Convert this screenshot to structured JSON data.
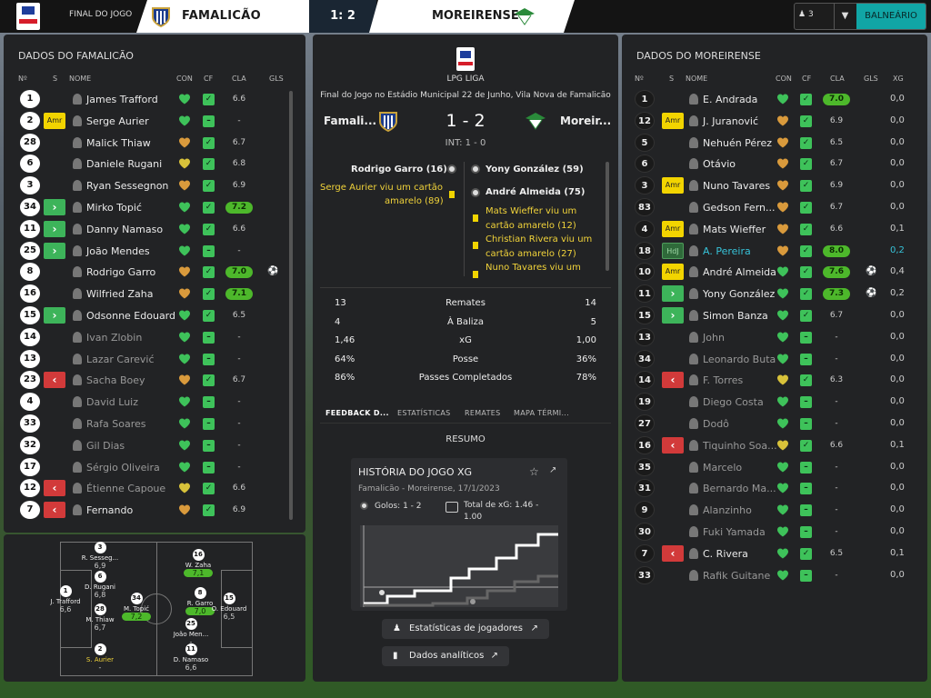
{
  "topbar": {
    "status": "FINAL DO JOGO",
    "home": "FAMALICÃO",
    "score": "1: 2",
    "away": "MOREIRENSE",
    "users": "3",
    "button": "BALNEÁRIO"
  },
  "home_panel": {
    "title": "DADOS DO FAMALICÃO",
    "headers": {
      "num": "Nº",
      "s": "S",
      "name": "NOME",
      "con": "CON",
      "cf": "CF",
      "cla": "CLA",
      "gls": "GLS"
    },
    "players": [
      {
        "num": "1",
        "badge": "",
        "name": "James Trafford",
        "con": "green",
        "cla": "6.6",
        "hi": false,
        "goal": false,
        "dim": false
      },
      {
        "num": "2",
        "badge": "Amr",
        "name": "Serge Aurier",
        "con": "green",
        "cla": "-",
        "hi": false,
        "goal": false,
        "dim": false
      },
      {
        "num": "28",
        "badge": "",
        "name": "Malick Thiaw",
        "con": "orange",
        "cla": "6.7",
        "hi": false,
        "goal": false,
        "dim": false
      },
      {
        "num": "6",
        "badge": "",
        "name": "Daniele Rugani",
        "con": "yellow",
        "cla": "6.8",
        "hi": false,
        "goal": false,
        "dim": false
      },
      {
        "num": "3",
        "badge": "",
        "name": "Ryan Sessegnon",
        "con": "orange",
        "cla": "6.9",
        "hi": false,
        "goal": false,
        "dim": false
      },
      {
        "num": "34",
        "badge": "in",
        "name": "Mirko Topić",
        "con": "green",
        "cla": "7.2",
        "hi": true,
        "goal": false,
        "dim": false
      },
      {
        "num": "11",
        "badge": "in",
        "name": "Danny Namaso",
        "con": "green",
        "cla": "6.6",
        "hi": false,
        "goal": false,
        "dim": false
      },
      {
        "num": "25",
        "badge": "in",
        "name": "João Mendes",
        "con": "green",
        "cla": "-",
        "hi": false,
        "goal": false,
        "dim": false
      },
      {
        "num": "8",
        "badge": "",
        "name": "Rodrigo Garro",
        "con": "orange",
        "cla": "7.0",
        "hi": true,
        "goal": true,
        "dim": false
      },
      {
        "num": "16",
        "badge": "",
        "name": "Wilfried Zaha",
        "con": "orange",
        "cla": "7.1",
        "hi": true,
        "goal": false,
        "dim": false
      },
      {
        "num": "15",
        "badge": "in",
        "name": "Odsonne Edouard",
        "con": "green",
        "cla": "6.5",
        "hi": false,
        "goal": false,
        "dim": false
      },
      {
        "num": "14",
        "badge": "",
        "name": "Ivan Zlobin",
        "con": "green",
        "cla": "-",
        "hi": false,
        "goal": false,
        "dim": true
      },
      {
        "num": "13",
        "badge": "",
        "name": "Lazar Carević",
        "con": "green",
        "cla": "-",
        "hi": false,
        "goal": false,
        "dim": true
      },
      {
        "num": "23",
        "badge": "out",
        "name": "Sacha Boey",
        "con": "orange",
        "cla": "6.7",
        "hi": false,
        "goal": false,
        "dim": true
      },
      {
        "num": "4",
        "badge": "",
        "name": "David Luiz",
        "con": "green",
        "cla": "-",
        "hi": false,
        "goal": false,
        "dim": true
      },
      {
        "num": "33",
        "badge": "",
        "name": "Rafa Soares",
        "con": "green",
        "cla": "-",
        "hi": false,
        "goal": false,
        "dim": true
      },
      {
        "num": "32",
        "badge": "",
        "name": "Gil Dias",
        "con": "green",
        "cla": "-",
        "hi": false,
        "goal": false,
        "dim": true
      },
      {
        "num": "17",
        "badge": "",
        "name": "Sérgio Oliveira",
        "con": "green",
        "cla": "-",
        "hi": false,
        "goal": false,
        "dim": true
      },
      {
        "num": "12",
        "badge": "out",
        "name": "Étienne Capoue",
        "con": "yellow",
        "cla": "6.6",
        "hi": false,
        "goal": false,
        "dim": true
      },
      {
        "num": "7",
        "badge": "out",
        "name": "Fernando",
        "con": "orange",
        "cla": "6.9",
        "hi": false,
        "goal": false,
        "dim": false
      }
    ]
  },
  "away_panel": {
    "title": "DADOS DO MOREIRENSE",
    "headers": {
      "num": "Nº",
      "s": "S",
      "name": "NOME",
      "con": "CON",
      "cf": "CF",
      "cla": "CLA",
      "gls": "GLS",
      "xg": "XG"
    },
    "players": [
      {
        "num": "1",
        "badge": "",
        "name": "E. Andrada",
        "con": "green",
        "cla": "7.0",
        "hi": true,
        "goal": false,
        "xg": "0,0",
        "dim": false,
        "cyan": false
      },
      {
        "num": "12",
        "badge": "Amr",
        "name": "J. Juranović",
        "con": "orange",
        "cla": "6.9",
        "hi": false,
        "goal": false,
        "xg": "0,0",
        "dim": false,
        "cyan": false
      },
      {
        "num": "5",
        "badge": "",
        "name": "Nehuén Pérez",
        "con": "orange",
        "cla": "6.5",
        "hi": false,
        "goal": false,
        "xg": "0,0",
        "dim": false,
        "cyan": false
      },
      {
        "num": "6",
        "badge": "",
        "name": "Otávio",
        "con": "orange",
        "cla": "6.7",
        "hi": false,
        "goal": false,
        "xg": "0,0",
        "dim": false,
        "cyan": false
      },
      {
        "num": "3",
        "badge": "Amr",
        "name": "Nuno Tavares",
        "con": "orange",
        "cla": "6.9",
        "hi": false,
        "goal": false,
        "xg": "0,0",
        "dim": false,
        "cyan": false
      },
      {
        "num": "83",
        "badge": "",
        "name": "Gedson Fern...",
        "con": "orange",
        "cla": "6.7",
        "hi": false,
        "goal": false,
        "xg": "0,0",
        "dim": false,
        "cyan": false
      },
      {
        "num": "4",
        "badge": "Amr",
        "name": "Mats Wieffer",
        "con": "orange",
        "cla": "6.6",
        "hi": false,
        "goal": false,
        "xg": "0,1",
        "dim": false,
        "cyan": false
      },
      {
        "num": "18",
        "badge": "HdJ",
        "name": "A. Pereira",
        "con": "orange",
        "cla": "8.0",
        "hi": true,
        "goal": false,
        "xg": "0,2",
        "dim": false,
        "cyan": true
      },
      {
        "num": "10",
        "badge": "Amr",
        "name": "André Almeida",
        "con": "green",
        "cla": "7.6",
        "hi": true,
        "goal": true,
        "xg": "0,4",
        "dim": false,
        "cyan": false
      },
      {
        "num": "11",
        "badge": "in",
        "name": "Yony González",
        "con": "green",
        "cla": "7.3",
        "hi": true,
        "goal": true,
        "xg": "0,2",
        "dim": false,
        "cyan": false
      },
      {
        "num": "15",
        "badge": "in",
        "name": "Simon Banza",
        "con": "green",
        "cla": "6.7",
        "hi": false,
        "goal": false,
        "xg": "0,0",
        "dim": false,
        "cyan": false
      },
      {
        "num": "13",
        "badge": "",
        "name": "John",
        "con": "green",
        "cla": "-",
        "hi": false,
        "goal": false,
        "xg": "0,0",
        "dim": true,
        "cyan": false
      },
      {
        "num": "34",
        "badge": "",
        "name": "Leonardo Buta",
        "con": "green",
        "cla": "-",
        "hi": false,
        "goal": false,
        "xg": "0,0",
        "dim": true,
        "cyan": false
      },
      {
        "num": "14",
        "badge": "out",
        "name": "F. Torres",
        "con": "yellow",
        "cla": "6.3",
        "hi": false,
        "goal": false,
        "xg": "0,0",
        "dim": true,
        "cyan": false
      },
      {
        "num": "19",
        "badge": "",
        "name": "Diego Costa",
        "con": "green",
        "cla": "-",
        "hi": false,
        "goal": false,
        "xg": "0,0",
        "dim": true,
        "cyan": false
      },
      {
        "num": "27",
        "badge": "",
        "name": "Dodô",
        "con": "green",
        "cla": "-",
        "hi": false,
        "goal": false,
        "xg": "0,0",
        "dim": true,
        "cyan": false
      },
      {
        "num": "16",
        "badge": "out",
        "name": "Tiquinho Soa...",
        "con": "yellow",
        "cla": "6.6",
        "hi": false,
        "goal": false,
        "xg": "0,1",
        "dim": true,
        "cyan": false
      },
      {
        "num": "35",
        "badge": "",
        "name": "Marcelo",
        "con": "green",
        "cla": "-",
        "hi": false,
        "goal": false,
        "xg": "0,0",
        "dim": true,
        "cyan": false
      },
      {
        "num": "31",
        "badge": "",
        "name": "Bernardo Ma...",
        "con": "green",
        "cla": "-",
        "hi": false,
        "goal": false,
        "xg": "0,0",
        "dim": true,
        "cyan": false
      },
      {
        "num": "9",
        "badge": "",
        "name": "Alanzinho",
        "con": "green",
        "cla": "-",
        "hi": false,
        "goal": false,
        "xg": "0,0",
        "dim": true,
        "cyan": false
      },
      {
        "num": "30",
        "badge": "",
        "name": "Fuki Yamada",
        "con": "green",
        "cla": "-",
        "hi": false,
        "goal": false,
        "xg": "0,0",
        "dim": true,
        "cyan": false
      },
      {
        "num": "7",
        "badge": "out",
        "name": "C. Rivera",
        "con": "green",
        "cla": "6.5",
        "hi": false,
        "goal": false,
        "xg": "0,1",
        "dim": false,
        "cyan": false
      },
      {
        "num": "33",
        "badge": "",
        "name": "Rafik Guitane",
        "con": "green",
        "cla": "-",
        "hi": false,
        "goal": false,
        "xg": "0,0",
        "dim": true,
        "cyan": false
      }
    ]
  },
  "match": {
    "league": "LPG LIGA",
    "venue": "Final do Jogo no Estádio Municipal 22 de Junho, Vila Nova de Famalicão",
    "home_short": "Famali...",
    "away_short": "Moreir...",
    "score": "1 - 2",
    "halftime": "INT: 1 - 0",
    "home_events": {
      "goal": "Rodrigo Garro (16)",
      "card1": "Serge Aurier viu um cartão",
      "card2": "amarelo (89)"
    },
    "away_events": {
      "goal1": "Yony González (59)",
      "goal2": "André Almeida (75)",
      "c1a": "Mats Wieffer viu um",
      "c1b": "cartão amarelo (12)",
      "c2a": "Christian Rivera viu um",
      "c2b": "cartão amarelo (27)",
      "c3a": "Nuno Tavares viu um"
    }
  },
  "stats": [
    {
      "home": "13",
      "label": "Remates",
      "away": "14"
    },
    {
      "home": "4",
      "label": "À Baliza",
      "away": "5"
    },
    {
      "home": "1,46",
      "label": "xG",
      "away": "1,00"
    },
    {
      "home": "64%",
      "label": "Posse",
      "away": "36%"
    },
    {
      "home": "86%",
      "label": "Passes Completados",
      "away": "78%"
    }
  ],
  "tabs": {
    "t1": "FEEDBACK D...",
    "t2": "ESTATÍSTICAS",
    "t3": "REMATES",
    "t4": "MAPA TÉRMI..."
  },
  "summary": {
    "heading": "RESUMO",
    "card_title": "HISTÓRIA DO JOGO XG",
    "card_sub": "Famalicão - Moreirense, 17/1/2023",
    "goals": "Golos: 1 - 2",
    "total_xg": "Total de xG: 1.46 - 1.00",
    "btn1": "Estatísticas de jogadores",
    "btn2": "Dados analíticos"
  },
  "formation": [
    {
      "num": "1",
      "name": "J. Trafford",
      "rate": "6,6",
      "hi": false
    },
    {
      "num": "2",
      "name": "S. Aurier",
      "rate": "-",
      "hi": false
    },
    {
      "num": "28",
      "name": "M. Thiaw",
      "rate": "6,7",
      "hi": false
    },
    {
      "num": "6",
      "name": "D. Rugani",
      "rate": "6,8",
      "hi": false
    },
    {
      "num": "3",
      "name": "R. Sesseg...",
      "rate": "6,9",
      "hi": false
    },
    {
      "num": "34",
      "name": "M. Topić",
      "rate": "7,2",
      "hi": true
    },
    {
      "num": "11",
      "name": "D. Namaso",
      "rate": "6,6",
      "hi": false
    },
    {
      "num": "25",
      "name": "João Men...",
      "rate": "-",
      "hi": false
    },
    {
      "num": "8",
      "name": "R. Garro",
      "rate": "7,0",
      "hi": true
    },
    {
      "num": "16",
      "name": "W. Zaha",
      "rate": "7,1",
      "hi": true
    },
    {
      "num": "15",
      "name": "O. Edouard",
      "rate": "6,5",
      "hi": false
    }
  ]
}
